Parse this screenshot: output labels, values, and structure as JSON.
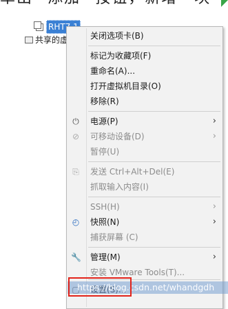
{
  "caption": "单出 \"添加\" 按钮，新增一块",
  "tree": {
    "vm_label": "RHT7.1",
    "shared_label": "共享的虚拟机"
  },
  "menu": {
    "items": [
      {
        "label": "关闭选项卡(B)",
        "disabled": false
      },
      {
        "label": "标记为收藏项(F)",
        "disabled": false
      },
      {
        "label": "重命名(A)...",
        "disabled": false
      },
      {
        "label": "打开虚拟机目录(O)",
        "disabled": false
      },
      {
        "label": "移除(R)",
        "disabled": false
      },
      {
        "label": "电源(P)",
        "disabled": false,
        "submenu": true,
        "icon": "power-icon"
      },
      {
        "label": "可移动设备(D)",
        "disabled": true,
        "submenu": true,
        "icon": "removable-device-icon"
      },
      {
        "label": "暂停(U)",
        "disabled": true
      },
      {
        "label": "发送 Ctrl+Alt+Del(E)",
        "disabled": true,
        "icon": "send-keys-icon"
      },
      {
        "label": "抓取输入内容(I)",
        "disabled": true
      },
      {
        "label": "SSH(H)",
        "disabled": true,
        "submenu": true
      },
      {
        "label": "快照(N)",
        "disabled": false,
        "submenu": true,
        "icon": "snapshot-icon"
      },
      {
        "label": "捕获屏幕 (C)",
        "disabled": true
      },
      {
        "label": "管理(M)",
        "disabled": false,
        "submenu": true,
        "icon": "wrench-icon"
      },
      {
        "label": "安装 VMware Tools(T)...",
        "disabled": true
      },
      {
        "label": "设置(S)...",
        "disabled": false,
        "icon": "settings-icon"
      }
    ]
  },
  "watermark": "https://blog.csdn.net/whandgdh",
  "colors": {
    "selection": "#3a80d4",
    "highlight_box": "#e2231a",
    "menu_bg": "#f2f2f2"
  }
}
